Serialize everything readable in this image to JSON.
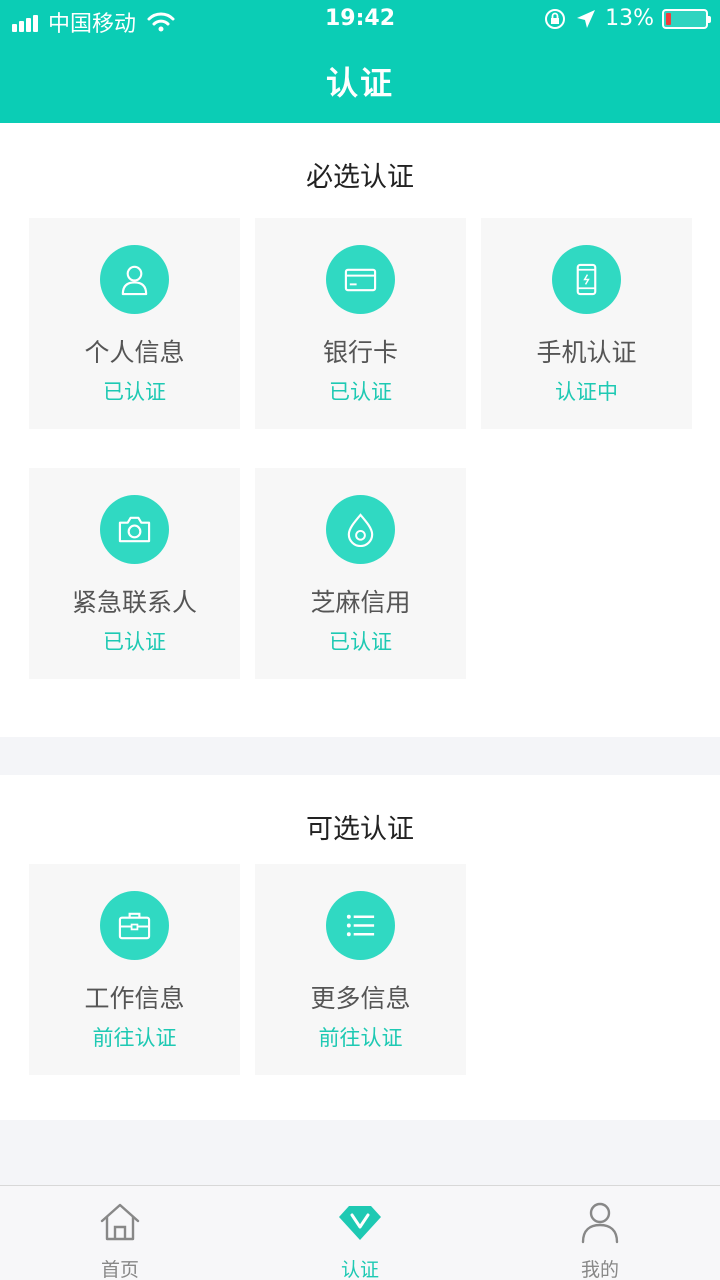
{
  "status_bar": {
    "carrier": "中国移动",
    "time": "19:42",
    "battery": "13%",
    "battery_level": 0.13,
    "icons": [
      "signal-icon",
      "wifi-icon",
      "rotation-lock-icon",
      "location-arrow-icon",
      "battery-icon"
    ]
  },
  "nav": {
    "title": "认证"
  },
  "required": {
    "title": "必选认证",
    "items": [
      {
        "name": "个人信息",
        "status": "已认证",
        "icon": "person-icon"
      },
      {
        "name": "银行卡",
        "status": "已认证",
        "icon": "bank-card-icon"
      },
      {
        "name": "手机认证",
        "status": "认证中",
        "icon": "phone-icon"
      },
      {
        "name": "紧急联系人",
        "status": "已认证",
        "icon": "camera-icon"
      },
      {
        "name": "芝麻信用",
        "status": "已认证",
        "icon": "sesame-credit-icon"
      }
    ]
  },
  "optional": {
    "title": "可选认证",
    "items": [
      {
        "name": "工作信息",
        "status": "前往认证",
        "icon": "briefcase-icon"
      },
      {
        "name": "更多信息",
        "status": "前往认证",
        "icon": "list-icon"
      }
    ]
  },
  "tabbar": {
    "items": [
      {
        "label": "首页",
        "icon": "home-icon"
      },
      {
        "label": "认证",
        "icon": "certify-diamond-icon",
        "active": true
      },
      {
        "label": "我的",
        "icon": "profile-icon"
      }
    ]
  },
  "colors": {
    "accent": "#0bcdb5",
    "icon_bg": "#30d9c2",
    "status_text": "#1ec9b3",
    "card_bg": "#f7f7f7",
    "page_bg": "#f4f5f8"
  }
}
